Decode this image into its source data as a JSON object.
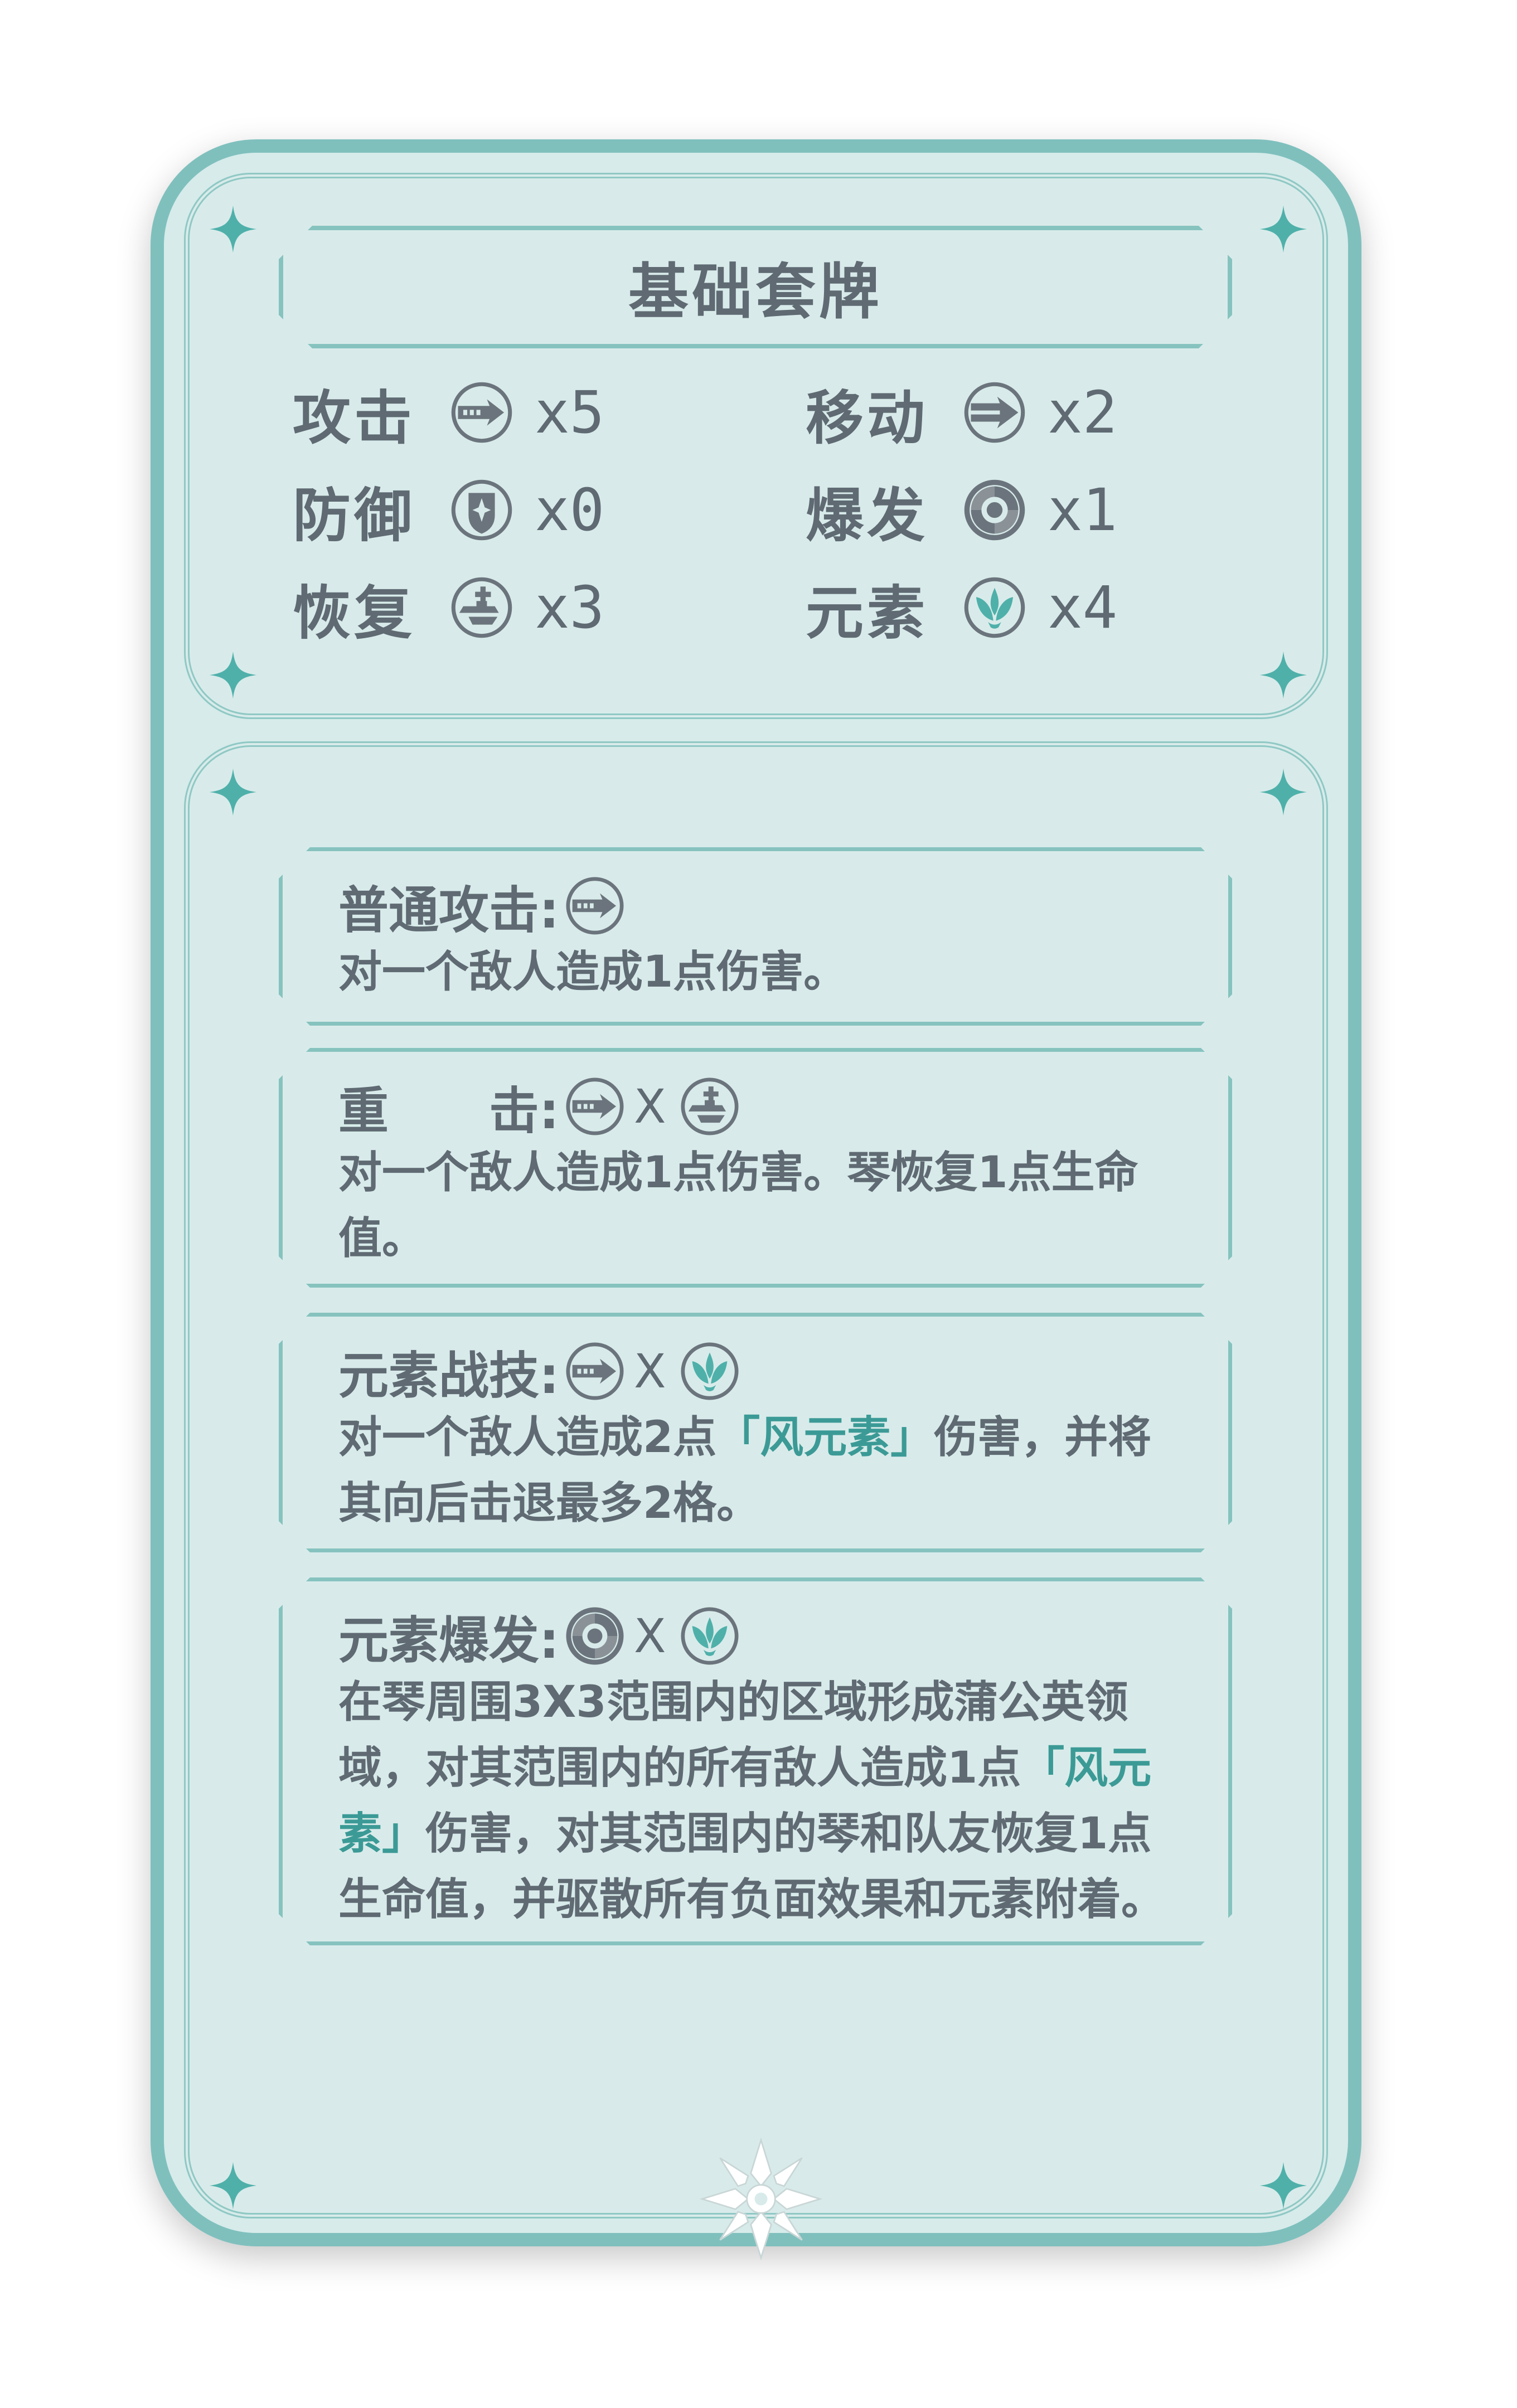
{
  "colors": {
    "frame": "#7fc0bd",
    "panel": "#d8ebea",
    "text": "#5f6a73",
    "anemo": "#3b9a96",
    "icon": "#6b747c"
  },
  "deck": {
    "title": "基础套牌",
    "stats": [
      {
        "label": "攻击",
        "icon": "attack-icon",
        "count": "x5"
      },
      {
        "label": "移动",
        "icon": "move-icon",
        "count": "x2"
      },
      {
        "label": "防御",
        "icon": "defense-icon",
        "count": "x0"
      },
      {
        "label": "爆发",
        "icon": "burst-icon",
        "count": "x1"
      },
      {
        "label": "恢复",
        "icon": "heal-icon",
        "count": "x3"
      },
      {
        "label": "元素",
        "icon": "anemo-icon",
        "count": "x4"
      }
    ]
  },
  "skills": {
    "times": "X",
    "normal": {
      "name": "普通攻击:",
      "desc": "对一个敌人造成1点伤害。"
    },
    "heavy": {
      "name": "重　　击:",
      "desc": "对一个敌人造成1点伤害。琴恢复1点生命值。"
    },
    "skill": {
      "name": "元素战技:",
      "desc_a": "对一个敌人造成2点",
      "desc_element": "「风元素」",
      "desc_b": "伤害，并将其向后击退最多2格。"
    },
    "burst": {
      "name": "元素爆发:",
      "desc_a": "在琴周围3X3范围内的区域形成蒲公英领域，对其范围内的所有敌人造成1点",
      "desc_element": "「风元素」",
      "desc_b": "伤害，对其范围内的琴和队友恢复1点生命值，并驱散所有负面效果和元素附着。"
    }
  }
}
